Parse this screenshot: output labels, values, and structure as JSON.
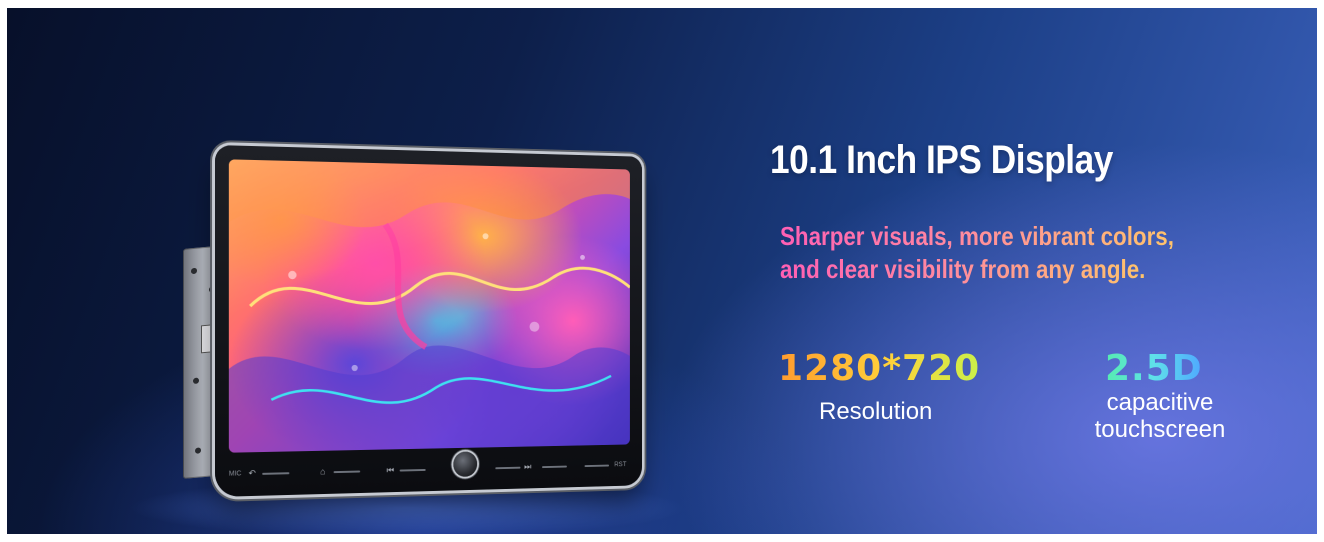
{
  "headline": "10.1 Inch IPS Display",
  "subheadline": {
    "line1": "Sharper visuals, more vibrant colors,",
    "line2": "and clear visibility from any angle."
  },
  "specs": [
    {
      "value": "1280*720",
      "label_lines": [
        "Resolution"
      ]
    },
    {
      "value": "2.5D",
      "label_lines": [
        "capacitive",
        "touchscreen"
      ]
    }
  ],
  "device": {
    "button_labels": {
      "mic": "MIC",
      "rst": "RST"
    }
  },
  "colors": {
    "headline": "#ffffff",
    "subheadline_gradient": [
      "#ff5fb4",
      "#ffc46a"
    ],
    "resolution_gradient": [
      "#ff9b2e",
      "#c9f04a"
    ],
    "touch_gradient": [
      "#56ecb0",
      "#4fa8ff"
    ],
    "background": "#1c3f86"
  }
}
